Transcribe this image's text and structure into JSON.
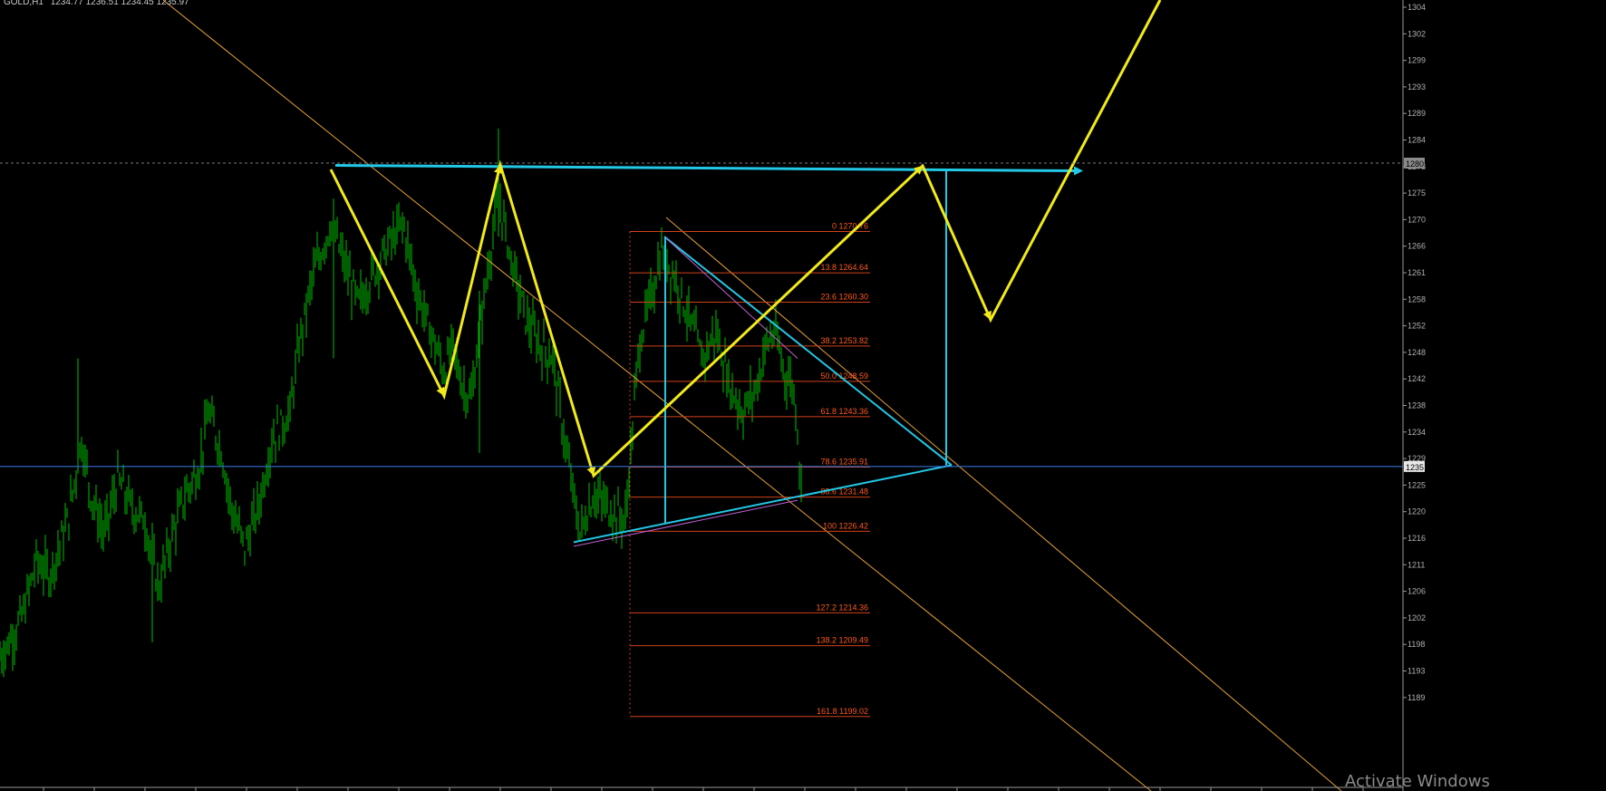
{
  "header": {
    "symbol": "GOLD,H1",
    "ohlc": "1234.77 1236.51 1234.45 1235.97"
  },
  "watermark": "Activate Windows",
  "colors": {
    "background": "#000000",
    "candles": "#00c000",
    "fib_lines": "#d0401a",
    "fib_text": "#ff5a1e",
    "trend_lines": "#e7a03a",
    "pattern_lines": "#22c8e6",
    "projection": "#f2ea1a",
    "price_line": "#3a7ee6",
    "axis": "#9a9a9a",
    "watermark": "#8a8a8a"
  },
  "chart_data": {
    "type": "candlestick",
    "symbol": "GOLD",
    "timeframe": "H1",
    "ylim": [
      1188,
      1305
    ],
    "y_ticks": [
      "1304",
      "1302",
      "1299",
      "1293",
      "1289",
      "1284",
      "1278",
      "1275",
      "1270",
      "1266",
      "1261",
      "1258",
      "1252",
      "1248",
      "1242",
      "1238",
      "1234",
      "1229",
      "1225",
      "1220",
      "1216",
      "1211",
      "1206",
      "1202",
      "1198",
      "1193",
      "1189"
    ],
    "current_price_label": "1235",
    "resistance_label": "1280",
    "current_price": 1236.0,
    "resistance_level": 1280.0,
    "fibonacci_levels": [
      {
        "label": "0 1270.76",
        "value": 1270.76
      },
      {
        "label": "13.8 1264.64",
        "value": 1264.64
      },
      {
        "label": "23.6 1260.30",
        "value": 1260.3
      },
      {
        "label": "38.2 1253.82",
        "value": 1253.82
      },
      {
        "label": "50.0 1248.59",
        "value": 1248.59
      },
      {
        "label": "61.8 1243.36",
        "value": 1243.36
      },
      {
        "label": "78.6 1235.91",
        "value": 1235.91
      },
      {
        "label": "88.6 1231.48",
        "value": 1231.48
      },
      {
        "label": "100 1226.42",
        "value": 1226.42
      },
      {
        "label": "127.2 1214.36",
        "value": 1214.36
      },
      {
        "label": "138.2 1209.49",
        "value": 1209.49
      },
      {
        "label": "161.8 1199.02",
        "value": 1199.02
      }
    ],
    "price_path": [
      [
        0,
        1208
      ],
      [
        10,
        1210
      ],
      [
        25,
        1214
      ],
      [
        40,
        1222
      ],
      [
        55,
        1220
      ],
      [
        75,
        1228
      ],
      [
        90,
        1240
      ],
      [
        100,
        1232
      ],
      [
        115,
        1226
      ],
      [
        130,
        1234
      ],
      [
        145,
        1230
      ],
      [
        160,
        1228
      ],
      [
        175,
        1218
      ],
      [
        190,
        1226
      ],
      [
        205,
        1232
      ],
      [
        220,
        1236
      ],
      [
        230,
        1244
      ],
      [
        245,
        1238
      ],
      [
        255,
        1230
      ],
      [
        270,
        1224
      ],
      [
        285,
        1230
      ],
      [
        300,
        1240
      ],
      [
        320,
        1244
      ],
      [
        330,
        1254
      ],
      [
        345,
        1264
      ],
      [
        365,
        1272
      ],
      [
        380,
        1266
      ],
      [
        395,
        1260
      ],
      [
        410,
        1264
      ],
      [
        425,
        1268
      ],
      [
        445,
        1272
      ],
      [
        460,
        1262
      ],
      [
        475,
        1256
      ],
      [
        490,
        1250
      ],
      [
        500,
        1254
      ],
      [
        510,
        1248
      ],
      [
        520,
        1246
      ],
      [
        535,
        1262
      ],
      [
        550,
        1276
      ],
      [
        565,
        1266
      ],
      [
        580,
        1258
      ],
      [
        595,
        1254
      ],
      [
        610,
        1252
      ],
      [
        625,
        1238
      ],
      [
        640,
        1226
      ],
      [
        655,
        1232
      ],
      [
        670,
        1230
      ],
      [
        690,
        1228
      ],
      [
        705,
        1254
      ],
      [
        720,
        1262
      ],
      [
        730,
        1268
      ],
      [
        745,
        1264
      ],
      [
        760,
        1258
      ],
      [
        775,
        1252
      ],
      [
        790,
        1256
      ],
      [
        805,
        1248
      ],
      [
        820,
        1244
      ],
      [
        835,
        1248
      ],
      [
        845,
        1254
      ],
      [
        855,
        1256
      ],
      [
        865,
        1250
      ],
      [
        875,
        1248
      ],
      [
        880,
        1242
      ],
      [
        884,
        1232
      ]
    ]
  }
}
